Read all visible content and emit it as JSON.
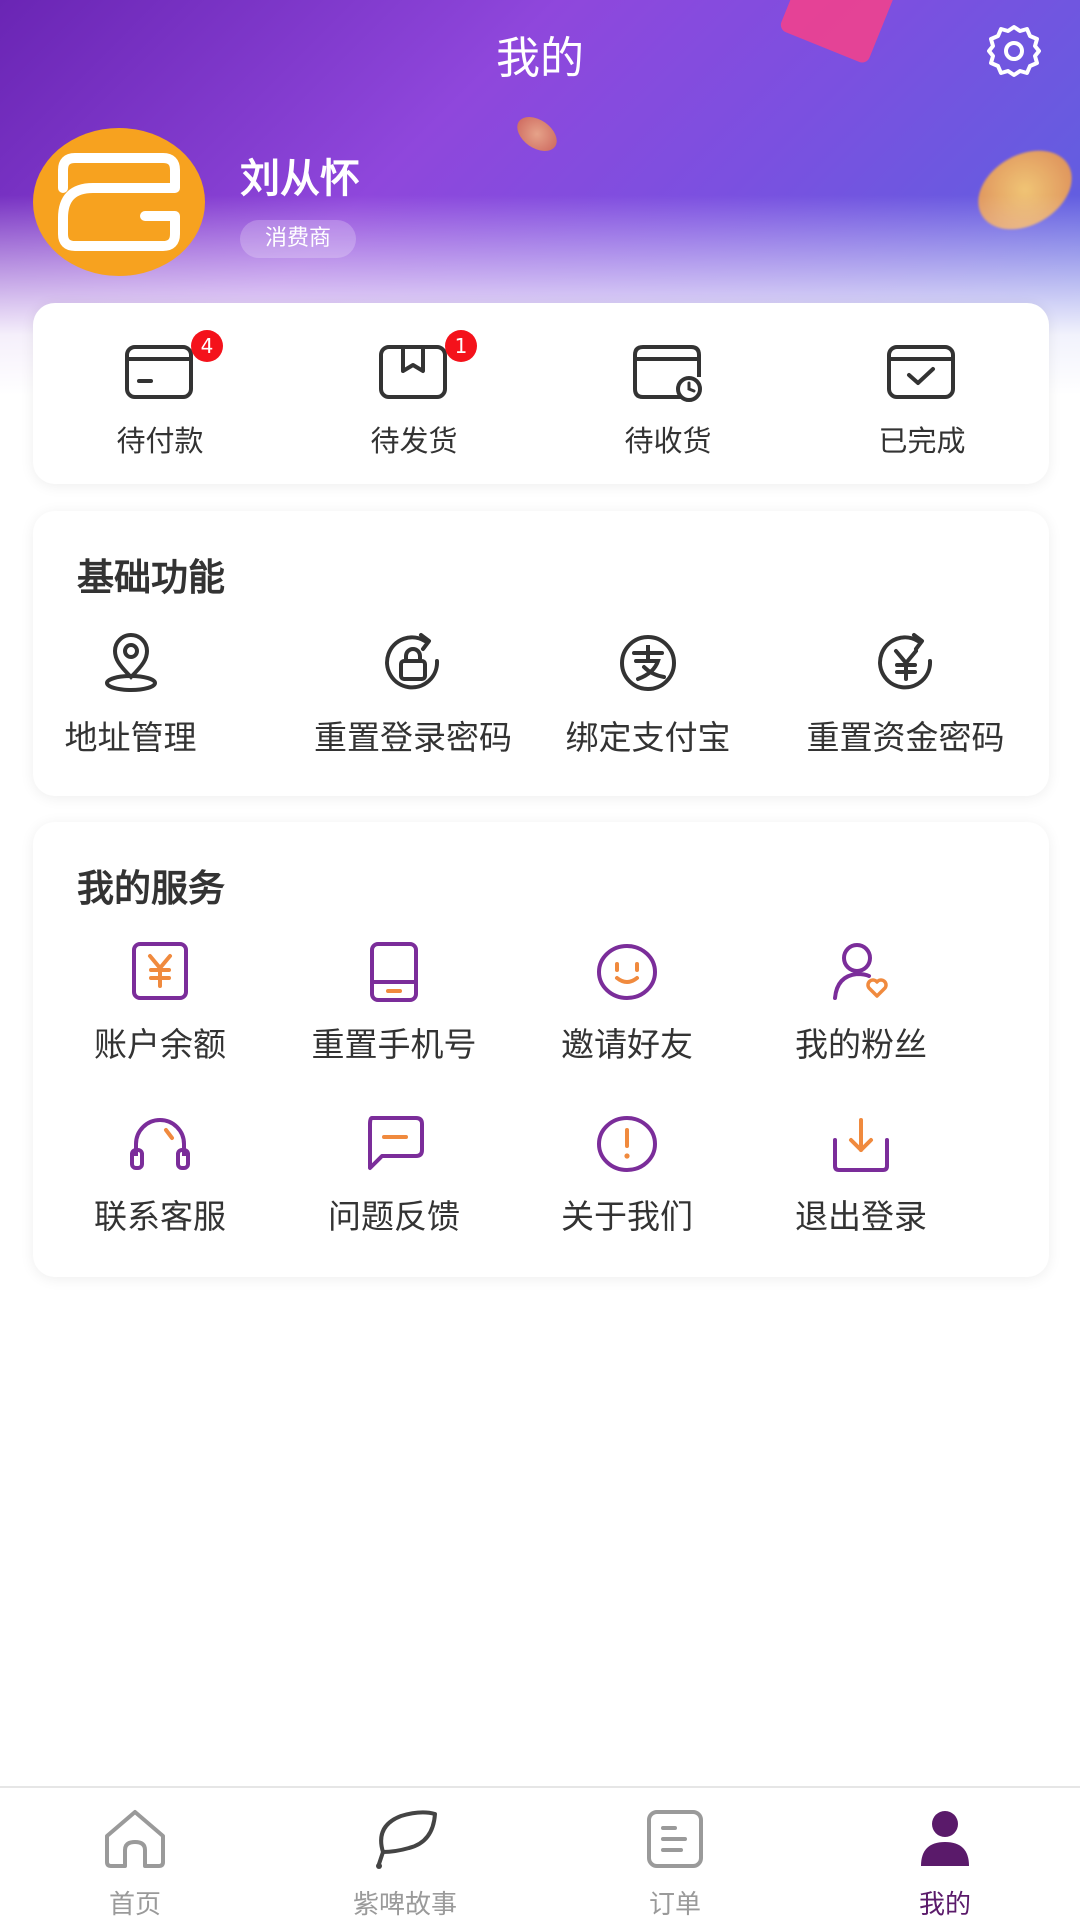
{
  "header": {
    "title": "我的",
    "settings_icon": "gear-icon"
  },
  "profile": {
    "name": "刘从怀",
    "role": "消费商",
    "avatar_color": "#f7a21f"
  },
  "orders": [
    {
      "label": "待付款",
      "icon": "wallet-card-icon",
      "badge": "4"
    },
    {
      "label": "待发货",
      "icon": "box-bookmark-icon",
      "badge": "1"
    },
    {
      "label": "待收货",
      "icon": "wallet-clock-icon",
      "badge": ""
    },
    {
      "label": "已完成",
      "icon": "wallet-check-icon",
      "badge": ""
    }
  ],
  "basic": {
    "title": "基础功能",
    "items": [
      {
        "label": "地址管理",
        "icon": "location-pin-icon"
      },
      {
        "label": "重置登录密码",
        "icon": "lock-refresh-icon"
      },
      {
        "label": "绑定支付宝",
        "icon": "alipay-icon"
      },
      {
        "label": "重置资金密码",
        "icon": "yuan-refresh-icon"
      }
    ]
  },
  "service": {
    "title": "我的服务",
    "items": [
      {
        "label": "账户余额",
        "icon": "yuan-box-icon"
      },
      {
        "label": "重置手机号",
        "icon": "phone-icon"
      },
      {
        "label": "邀请好友",
        "icon": "smile-icon"
      },
      {
        "label": "我的粉丝",
        "icon": "user-heart-icon"
      },
      {
        "label": "联系客服",
        "icon": "headset-icon"
      },
      {
        "label": "问题反馈",
        "icon": "message-icon"
      },
      {
        "label": "关于我们",
        "icon": "info-alert-icon"
      },
      {
        "label": "退出登录",
        "icon": "logout-download-icon"
      }
    ]
  },
  "tabbar": [
    {
      "label": "首页",
      "icon": "home-icon",
      "active": false
    },
    {
      "label": "紫啤故事",
      "icon": "leaf-chat-icon",
      "active": false
    },
    {
      "label": "订单",
      "icon": "order-list-icon",
      "active": false
    },
    {
      "label": "我的",
      "icon": "user-icon",
      "active": true
    }
  ],
  "colors": {
    "purple": "#7b2d9a",
    "orange": "#f08a3e",
    "badge_red": "#f4121b",
    "active_tab": "#5a1a6a"
  }
}
